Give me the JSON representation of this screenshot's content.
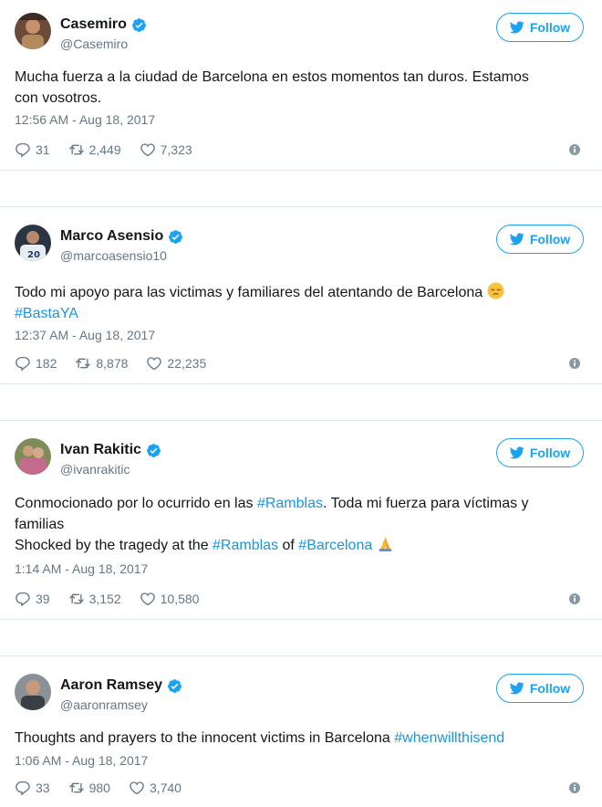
{
  "tweets": [
    {
      "name": "Casemiro",
      "handle": "@Casemiro",
      "follow_label": "Follow",
      "text_line1": "Mucha fuerza a la ciudad de Barcelona en estos momentos tan duros. Estamos",
      "text_line2": "con vosotros.",
      "time": "12:56 AM - Aug 18, 2017",
      "replies": "31",
      "retweets": "2,449",
      "likes": "7,323"
    },
    {
      "name": "Marco Asensio",
      "handle": "@marcoasensio10",
      "follow_label": "Follow",
      "text_line1": "Todo mi apoyo para las victimas y familiares del atentando de Barcelona",
      "emoji": "pensive-face",
      "hashtag": "#BastaYA",
      "time": "12:37 AM - Aug 18, 2017",
      "replies": "182",
      "retweets": "8,878",
      "likes": "22,235"
    },
    {
      "name": "Ivan Rakitic",
      "handle": "@ivanrakitic",
      "follow_label": "Follow",
      "text_line1_a": "Conmocionado por lo ocurrido en las ",
      "text_line1_tag": "#Ramblas",
      "text_line1_b": ". Toda mi fuerza para víctimas y",
      "text_line2": "familias",
      "text_line3_a": "Shocked by the tragedy at the ",
      "text_line3_tag1": "#Ramblas",
      "text_line3_b": " of ",
      "text_line3_tag2": "#Barcelona",
      "emoji": "folded-hands",
      "time": "1:14 AM - Aug 18, 2017",
      "replies": "39",
      "retweets": "3,152",
      "likes": "10,580"
    },
    {
      "name": "Aaron Ramsey",
      "handle": "@aaronramsey",
      "follow_label": "Follow",
      "text_a": "Thoughts and prayers to the innocent victims in Barcelona ",
      "text_tag": "#whenwillthisend",
      "time": "1:06 AM - Aug 18, 2017",
      "replies": "33",
      "retweets": "980",
      "likes": "3,740"
    }
  ],
  "colors": {
    "accent": "#1da1f2",
    "link": "#1b95e0",
    "muted": "#657786",
    "border": "#e1e8ed"
  }
}
